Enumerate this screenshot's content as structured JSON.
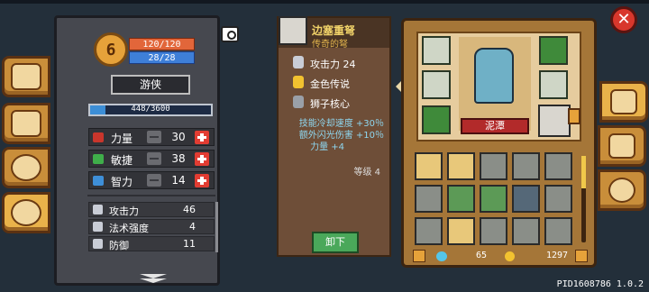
{
  "player": {
    "level": "6",
    "hp": "120/120",
    "mp": "28/28",
    "class": "游侠",
    "xp": "448/3600",
    "xp_fraction": 0.124
  },
  "stats": [
    {
      "name": "力量",
      "value": "30",
      "icon": "fist-icon",
      "color": "#c9362c"
    },
    {
      "name": "敏捷",
      "value": "38",
      "icon": "feather-icon",
      "color": "#3fae4a"
    },
    {
      "name": "智力",
      "value": "14",
      "icon": "book-icon",
      "color": "#3e8fd8"
    }
  ],
  "substats": [
    {
      "name": "攻击力",
      "value": "46",
      "icon": "sword-icon"
    },
    {
      "name": "法术强度",
      "value": "4",
      "icon": "wand-icon"
    },
    {
      "name": "防御",
      "value": "11",
      "icon": "shield-icon"
    }
  ],
  "tooltip": {
    "title": "边塞重弩",
    "rarity": "传奇的弩",
    "lines": [
      {
        "text": "攻击力 24",
        "icon": "sword-icon",
        "color": "#c9cdd6"
      },
      {
        "text": "金色传说",
        "icon": "gold-flame-icon",
        "color": "#f2c230"
      },
      {
        "text": "狮子核心",
        "icon": "lion-core-icon",
        "color": "#9aa0a8"
      }
    ],
    "bonuses": [
      "技能冷却速度 +30％",
      "额外闪光伤害 +10％",
      "力量 +4"
    ],
    "level": "等级 4",
    "unequip": "卸下"
  },
  "hero": {
    "name": "泥潭"
  },
  "currency": {
    "gems": "65",
    "coins": "1297"
  },
  "footer": {
    "pid": "PID1608786 1.0.2"
  }
}
